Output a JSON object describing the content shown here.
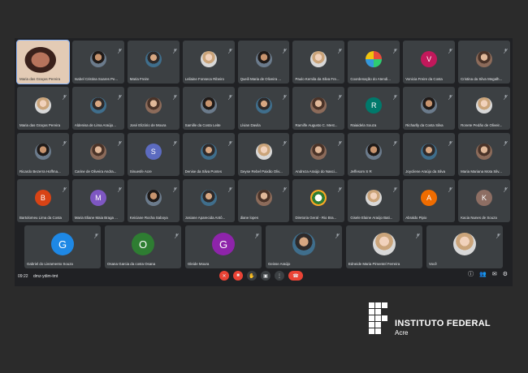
{
  "colors": {
    "page_bg": "#2b2b2b",
    "meet_bg": "#202124",
    "tile_bg": "#3c4043",
    "end_call": "#ea4335"
  },
  "meeting": {
    "time": "09:22",
    "code": "dmz-ydim-tmt"
  },
  "rows": [
    [
      {
        "name": "Maria das Graças Pereira",
        "type": "self"
      },
      {
        "name": "Isabel Cristina Soares Pe...",
        "type": "photo",
        "style": "b"
      },
      {
        "name": "Maria Freire",
        "type": "photo",
        "style": "d"
      },
      {
        "name": "Leilaine Fonseca Ribeiro",
        "type": "photo",
        "style": "c"
      },
      {
        "name": "Queili Maria de Oliveira ...",
        "type": "photo",
        "style": "b"
      },
      {
        "name": "Paulo Kemila da Silva Fre...",
        "type": "photo",
        "style": "c"
      },
      {
        "name": "Coordenação do Atendi...",
        "type": "photo",
        "style": "e"
      },
      {
        "name": "Vonicia Freire da Costa",
        "type": "letter",
        "letter": "V",
        "color": "#c2185b"
      },
      {
        "name": "Cristina da Silva Megalh...",
        "type": "photo",
        "style": "a"
      }
    ],
    [
      {
        "name": "Maria das Graças Pereira",
        "type": "photo",
        "style": "c"
      },
      {
        "name": "Aldenisa de Lima Araújo...",
        "type": "photo",
        "style": "d"
      },
      {
        "name": "José Elizário de Moura",
        "type": "photo",
        "style": "a"
      },
      {
        "name": "Samille da Costa Leite",
        "type": "photo",
        "style": "b"
      },
      {
        "name": "Lívian Davila",
        "type": "photo",
        "style": "d"
      },
      {
        "name": "Ramilfe Augusto C. Mest...",
        "type": "photo",
        "style": "a"
      },
      {
        "name": "Raiaidela Souza",
        "type": "letter",
        "letter": "R",
        "color": "#00796b"
      },
      {
        "name": "Richarlly da Costa Silva",
        "type": "photo",
        "style": "b"
      },
      {
        "name": "Ronete Pedão de Oliveir...",
        "type": "photo",
        "style": "c"
      }
    ],
    [
      {
        "name": "Ricardo Bezerra Hoffma...",
        "type": "photo",
        "style": "b"
      },
      {
        "name": "Carine de Oliveira Andra...",
        "type": "photo",
        "style": "a"
      },
      {
        "name": "Sinuesfe Acre",
        "type": "letter",
        "letter": "S",
        "color": "#5c6bc0"
      },
      {
        "name": "Denise da Silva Pontes",
        "type": "photo",
        "style": "d"
      },
      {
        "name": "Geyse Rebel Paixão Oliv...",
        "type": "photo",
        "style": "c"
      },
      {
        "name": "Andreza Araújo do Nasci...",
        "type": "photo",
        "style": "a"
      },
      {
        "name": "Jeffesom S R",
        "type": "photo",
        "style": "b"
      },
      {
        "name": "Joycilene Araújo da Silva",
        "type": "photo",
        "style": "d"
      },
      {
        "name": "Maria Mariana Mota Silv...",
        "type": "photo",
        "style": "a"
      }
    ],
    [
      {
        "name": "Bartolomeu Lima da Costa",
        "type": "letter",
        "letter": "B",
        "color": "#d84315"
      },
      {
        "name": "Maria Eliane Maia Braga ...",
        "type": "letter",
        "letter": "M",
        "color": "#7e57c2"
      },
      {
        "name": "Keiciane Rocha Saboya",
        "type": "photo",
        "style": "b"
      },
      {
        "name": "Josiane Aparecida Antô...",
        "type": "photo",
        "style": "d"
      },
      {
        "name": "diane lopes",
        "type": "photo",
        "style": "a"
      },
      {
        "name": "Diretoria Geral - Rio Bra...",
        "type": "photo",
        "style": "f"
      },
      {
        "name": "Gisele Elaine Araújo Bati...",
        "type": "photo",
        "style": "c"
      },
      {
        "name": "Abraldo Pipio",
        "type": "letter",
        "letter": "A",
        "color": "#ef6c00"
      },
      {
        "name": "Kacia Nunes de Souza",
        "type": "letter",
        "letter": "K",
        "color": "#8d6e63"
      }
    ],
    [
      {
        "name": "Gabriel do Livramento Souza",
        "type": "letter",
        "letter": "G",
        "color": "#1e88e5"
      },
      {
        "name": "Osana Garcia da costa Osana",
        "type": "letter",
        "letter": "O",
        "color": "#2e7d32"
      },
      {
        "name": "Gleide Moura",
        "type": "letter",
        "letter": "G",
        "color": "#8e24aa"
      },
      {
        "name": "Geisse Araújo",
        "type": "photo",
        "style": "d"
      },
      {
        "name": "Edneide Maria Pimentel Ferreira",
        "type": "photo",
        "style": "c"
      },
      {
        "name": "Você",
        "type": "photo",
        "style": "c"
      }
    ]
  ],
  "controls": [
    {
      "name": "mic-off-button",
      "glyph": "✕",
      "red": true
    },
    {
      "name": "camera-off-button",
      "glyph": "■",
      "red": true
    },
    {
      "name": "raise-hand-button",
      "glyph": "✋",
      "red": false
    },
    {
      "name": "present-button",
      "glyph": "▣",
      "red": false
    },
    {
      "name": "more-options-button",
      "glyph": "⋮",
      "red": false
    }
  ],
  "end_call_glyph": "☎",
  "right_controls": [
    {
      "name": "info-icon",
      "glyph": "ⓘ"
    },
    {
      "name": "people-icon",
      "glyph": "👥"
    },
    {
      "name": "chat-icon",
      "glyph": "✉"
    },
    {
      "name": "activities-icon",
      "glyph": "⚙"
    }
  ],
  "institution": {
    "title": "INSTITUTO FEDERAL",
    "subtitle": "Acre"
  }
}
